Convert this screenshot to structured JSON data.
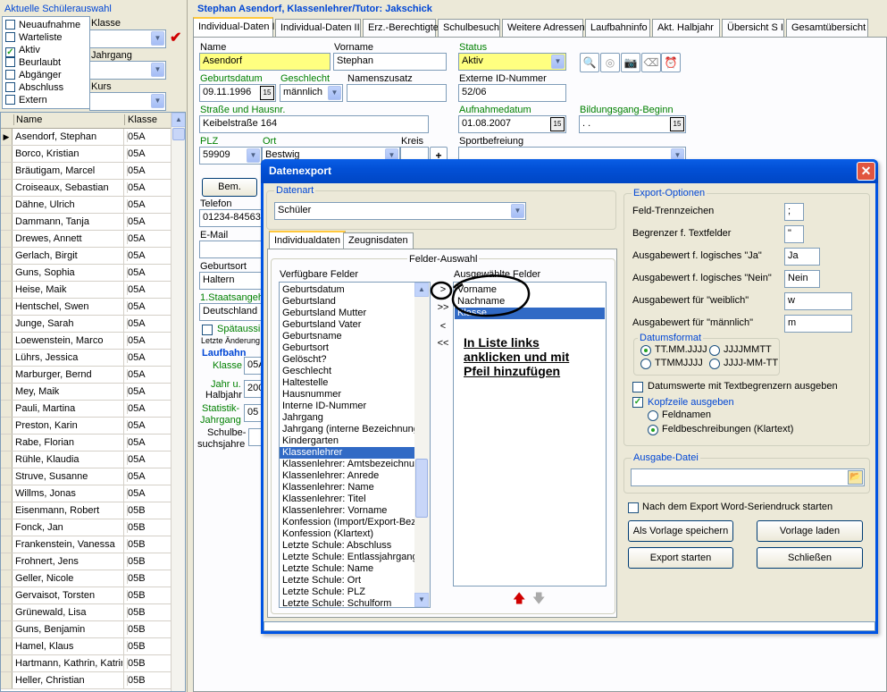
{
  "left_panel": {
    "title": "Aktuelle Schülerauswahl",
    "filters": [
      {
        "label": "Neuaufnahme",
        "checked": false
      },
      {
        "label": "Warteliste",
        "checked": false
      },
      {
        "label": "Aktiv",
        "checked": true
      },
      {
        "label": "Beurlaubt",
        "checked": false
      },
      {
        "label": "Abgänger",
        "checked": false
      },
      {
        "label": "Abschluss",
        "checked": false
      },
      {
        "label": "Extern",
        "checked": false
      }
    ],
    "klasse_label": "Klasse",
    "jahrgang_label": "Jahrgang",
    "kurs_label": "Kurs",
    "columns": {
      "name": "Name",
      "klasse": "Klasse"
    },
    "students": [
      {
        "name": "Asendorf, Stephan",
        "klasse": "05A"
      },
      {
        "name": "Borco, Kristian",
        "klasse": "05A"
      },
      {
        "name": "Bräutigam, Marcel",
        "klasse": "05A"
      },
      {
        "name": "Croiseaux, Sebastian",
        "klasse": "05A"
      },
      {
        "name": "Dähne, Ulrich",
        "klasse": "05A"
      },
      {
        "name": "Dammann, Tanja",
        "klasse": "05A"
      },
      {
        "name": "Drewes, Annett",
        "klasse": "05A"
      },
      {
        "name": "Gerlach, Birgit",
        "klasse": "05A"
      },
      {
        "name": "Guns, Sophia",
        "klasse": "05A"
      },
      {
        "name": "Heise, Maik",
        "klasse": "05A"
      },
      {
        "name": "Hentschel, Swen",
        "klasse": "05A"
      },
      {
        "name": "Junge, Sarah",
        "klasse": "05A"
      },
      {
        "name": "Loewenstein, Marco",
        "klasse": "05A"
      },
      {
        "name": "Lührs, Jessica",
        "klasse": "05A"
      },
      {
        "name": "Marburger, Bernd",
        "klasse": "05A"
      },
      {
        "name": "Mey, Maik",
        "klasse": "05A"
      },
      {
        "name": "Pauli, Martina",
        "klasse": "05A"
      },
      {
        "name": "Preston, Karin",
        "klasse": "05A"
      },
      {
        "name": "Rabe, Florian",
        "klasse": "05A"
      },
      {
        "name": "Rühle, Klaudia",
        "klasse": "05A"
      },
      {
        "name": "Struve, Susanne",
        "klasse": "05A"
      },
      {
        "name": "Willms, Jonas",
        "klasse": "05A"
      },
      {
        "name": "Eisenmann, Robert",
        "klasse": "05B"
      },
      {
        "name": "Fonck, Jan",
        "klasse": "05B"
      },
      {
        "name": "Frankenstein, Vanessa",
        "klasse": "05B"
      },
      {
        "name": "Frohnert, Jens",
        "klasse": "05B"
      },
      {
        "name": "Geller, Nicole",
        "klasse": "05B"
      },
      {
        "name": "Gervaisot, Torsten",
        "klasse": "05B"
      },
      {
        "name": "Grünewald, Lisa",
        "klasse": "05B"
      },
      {
        "name": "Guns, Benjamin",
        "klasse": "05B"
      },
      {
        "name": "Hamel, Klaus",
        "klasse": "05B"
      },
      {
        "name": "Hartmann, Kathrin, Katrin",
        "klasse": "05B"
      },
      {
        "name": "Heller, Christian",
        "klasse": "05B"
      }
    ]
  },
  "header": {
    "title": "Stephan Asendorf, Klassenlehrer/Tutor: Jakschick"
  },
  "tabs": [
    "Individual-Daten I",
    "Individual-Daten II",
    "Erz.-Berechtigte",
    "Schulbesuch",
    "Weitere Adressen",
    "Laufbahninfo",
    "Akt. Halbjahr",
    "Übersicht S I",
    "Gesamtübersicht"
  ],
  "form": {
    "name_label": "Name",
    "name": "Asendorf",
    "vorname_label": "Vorname",
    "vorname": "Stephan",
    "status_label": "Status",
    "status": "Aktiv",
    "geburtsdatum_label": "Geburtsdatum",
    "geburtsdatum": "09.11.1996",
    "geschlecht_label": "Geschlecht",
    "geschlecht": "männlich",
    "namenszusatz_label": "Namenszusatz",
    "namenszusatz": "",
    "externe_id_label": "Externe ID-Nummer",
    "externe_id": "52/06",
    "strasse_label": "Straße und Hausnr.",
    "strasse": "Keibelstraße 164",
    "aufnahmedatum_label": "Aufnahmedatum",
    "aufnahmedatum": "01.08.2007",
    "bildungsgang_label": "Bildungsgang-Beginn",
    "bildungsgang": ". .",
    "plz_label": "PLZ",
    "plz": "59909",
    "ort_label": "Ort",
    "ort": "Bestwig",
    "kreis_label": "Kreis",
    "sportbefreiung_label": "Sportbefreiung",
    "bem_button": "Bem.",
    "telefon_label": "Telefon",
    "telefon": "01234-84563",
    "email_label": "E-Mail",
    "geburtsort_label": "Geburtsort",
    "geburtsort": "Haltern",
    "staatsang_label": "1.Staatsangeh",
    "staatsang": "Deutschland",
    "spaetaus_label": "Spätaussi",
    "letzte_aenderung": "Letzte Änderung",
    "laufbahn_title": "Laufbahn",
    "klasse_label": "Klasse",
    "klasse": "05A",
    "jahr_label": "Jahr u.",
    "halbjahr_label": "Halbjahr",
    "jahr": "200",
    "statistik_label": "Statistik-",
    "statistik_jg_label": "Jahrgang",
    "statistik": "05",
    "schulbe_label": "Schulbe-",
    "suchsjahre_label": "suchsjahre"
  },
  "dialog": {
    "title": "Datenexport",
    "datenart_label": "Datenart",
    "datenart": "Schüler",
    "subtabs": [
      "Individualdaten",
      "Zeugnisdaten"
    ],
    "felder_auswahl": "Felder-Auswahl",
    "verfuegbar_label": "Verfügbare Felder",
    "ausgewaehlt_label": "Ausgewählte Felder",
    "verfuegbare_felder": [
      "Geburtsdatum",
      "Geburtsland",
      "Geburtsland Mutter",
      "Geburtsland Vater",
      "Geburtsname",
      "Geburtsort",
      "Gelöscht?",
      "Geschlecht",
      "Haltestelle",
      "Hausnummer",
      "Interne ID-Nummer",
      "Jahrgang",
      "Jahrgang (interne Bezeichnung",
      "Kindergarten",
      "Klassenlehrer",
      "Klassenlehrer: Amtsbezeichnun",
      "Klassenlehrer: Anrede",
      "Klassenlehrer: Name",
      "Klassenlehrer: Titel",
      "Klassenlehrer: Vorname",
      "Konfession (Import/Export-Bez.",
      "Konfession (Klartext)",
      "Letzte Schule: Abschluss",
      "Letzte Schule: Entlassjahrgang",
      "Letzte Schule: Name",
      "Letzte Schule: Ort",
      "Letzte Schule: PLZ",
      "Letzte Schule: Schulform"
    ],
    "ausgewaehlte_felder": [
      "Vorname",
      "Nachname",
      "Klasse"
    ],
    "arrow_buttons": [
      ">",
      ">>",
      "<",
      "<<"
    ],
    "annotation": [
      "In Liste links",
      "anklicken und mit",
      "Pfeil hinzufügen"
    ],
    "export_optionen": "Export-Optionen",
    "options": [
      {
        "label": "Feld-Trennzeichen",
        "value": ";"
      },
      {
        "label": "Begrenzer f. Textfelder",
        "value": "\""
      },
      {
        "label": "Ausgabewert f. logisches \"Ja\"",
        "value": "Ja"
      },
      {
        "label": "Ausgabewert f. logisches \"Nein\"",
        "value": "Nein"
      },
      {
        "label": "Ausgabewert für \"weiblich\"",
        "value": "w"
      },
      {
        "label": "Ausgabewert für \"männlich\"",
        "value": "m"
      }
    ],
    "datumsformat_label": "Datumsformat",
    "datumsformat": [
      "TT.MM.JJJJ",
      "JJJJMMTT",
      "TTMMJJJJ",
      "JJJJ-MM-TT"
    ],
    "datumswerte_label": "Datumswerte mit Textbegrenzern ausgeben",
    "kopfzeile_label": "Kopfzeile ausgeben",
    "feldnamen_label": "Feldnamen",
    "feldbeschreibungen_label": "Feldbeschreibungen (Klartext)",
    "ausgabe_datei_label": "Ausgabe-Datei",
    "word_serien_label": "Nach dem Export Word-Seriendruck starten",
    "buttons": {
      "vorlage_speichern": "Als Vorlage speichern",
      "vorlage_laden": "Vorlage laden",
      "export_starten": "Export starten",
      "schliessen": "Schließen"
    }
  },
  "colors": {
    "accent_blue": "#0046d5",
    "selection": "#316ac5",
    "required_yellow": "#ffff80",
    "title_bar": "#0054e3"
  }
}
